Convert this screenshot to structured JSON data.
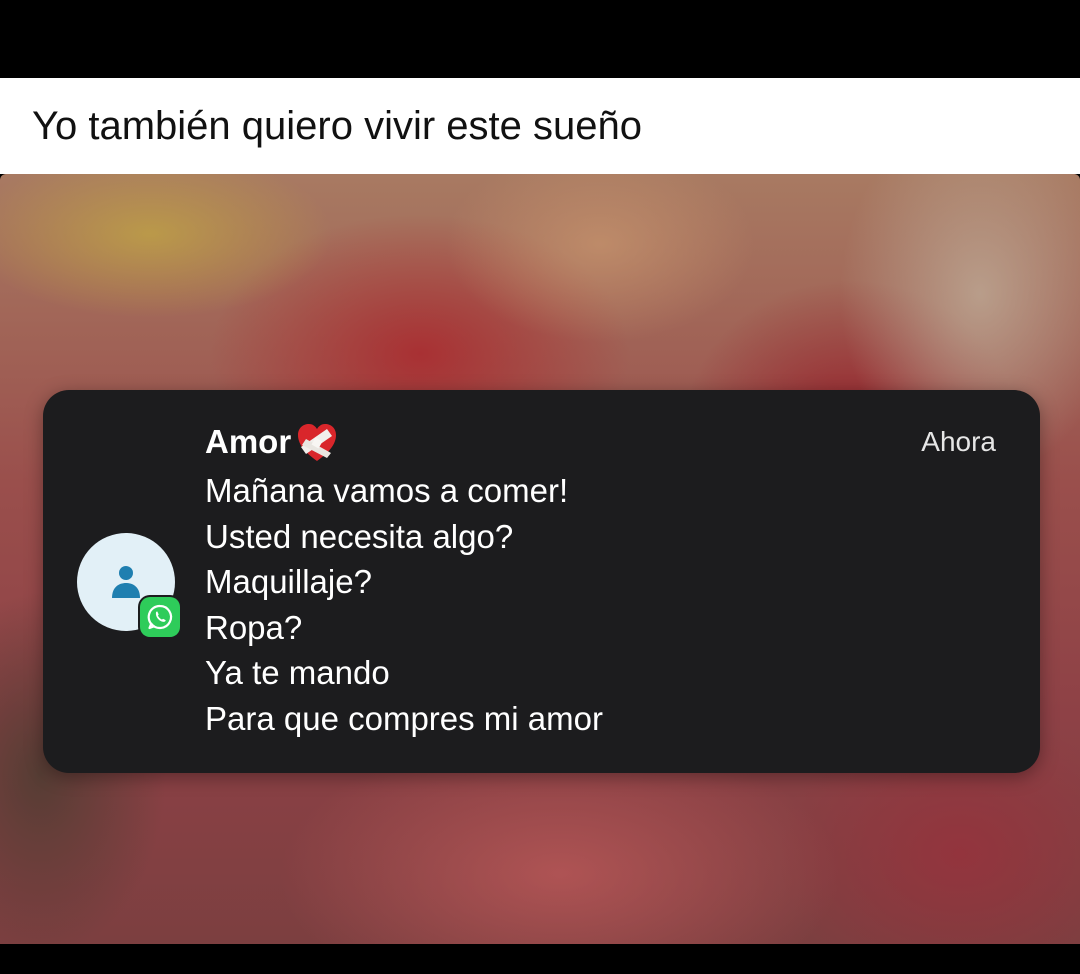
{
  "caption": {
    "text": "Yo también quiero vivir este sueño"
  },
  "notification": {
    "app_icon": "whatsapp-icon",
    "avatar_icon": "person-icon",
    "sender": "Amor",
    "sender_emoji": "heart-with-bandage-icon",
    "timestamp": "Ahora",
    "messages": [
      "Mañana vamos a comer!",
      "Usted necesita algo?",
      "Maquillaje?",
      "Ropa?",
      "Ya te mando",
      "Para que compres mi amor"
    ]
  },
  "colors": {
    "notification_bg": "#1c1c1e",
    "avatar_bg": "#e2f0f7",
    "person_icon": "#1f7fb0",
    "whatsapp_green": "#2ecc5a",
    "heart_red": "#d9262b",
    "bandage": "#f1efec"
  }
}
